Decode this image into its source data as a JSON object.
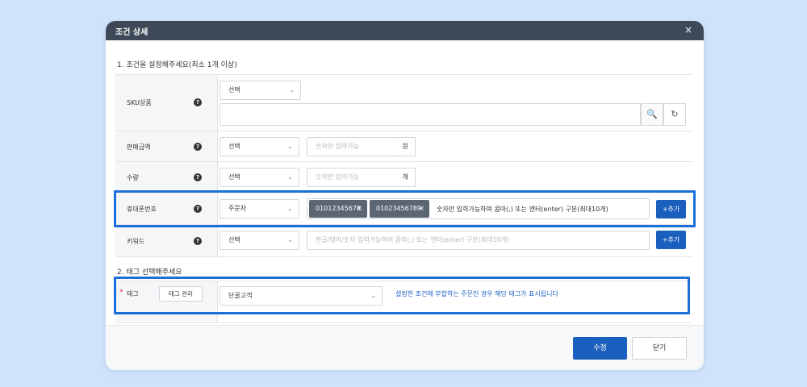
{
  "modal": {
    "title": "조건 상세",
    "close_icon": "×"
  },
  "section1": {
    "title": "1. 조건을 설정해주세요(최소 1개 이상)"
  },
  "section2": {
    "title": "2. 태그 선택해주세요"
  },
  "help_glyph": "?",
  "chevron_glyph": "⌄",
  "sku": {
    "label": "SKU상품",
    "select_value": "선택",
    "search_icon": "🔍",
    "refresh_icon": "↻"
  },
  "amount": {
    "label": "판매금액",
    "select_value": "선택",
    "placeholder": "숫자만 입력가능",
    "unit": "원"
  },
  "qty": {
    "label": "수량",
    "select_value": "선택",
    "placeholder": "숫자만 입력가능",
    "unit": "개"
  },
  "phone": {
    "label": "휴대폰번호",
    "select_value": "주문자",
    "tags": [
      "01012345678",
      "01023456789"
    ],
    "tag_remove": "×",
    "hint": "숫자만 입력가능하며 콤마(,) 또는 엔터(enter) 구분(최대10개)",
    "add_label": "+추가"
  },
  "keyword": {
    "label": "키워드",
    "select_value": "선택",
    "placeholder": "한글/영어/숫자 입력가능하며 콤마(,) 또는 엔터(enter) 구분(최대10개)",
    "add_label": "+추가"
  },
  "tag_row": {
    "required_mark": "*",
    "label": "태그",
    "manage_label": "태그 관리",
    "select_value": "단골고객",
    "description": "설정한 조건에 부합하는 주문인 경우 해당 태그가 표시됩니다"
  },
  "footer": {
    "save_label": "수정",
    "close_label": "닫기"
  },
  "colors": {
    "header_bg": "#3d4958",
    "primary": "#1b5fbe",
    "highlight": "#1b6fd9",
    "tag_bg": "#5b6672",
    "required": "#e0243a"
  }
}
